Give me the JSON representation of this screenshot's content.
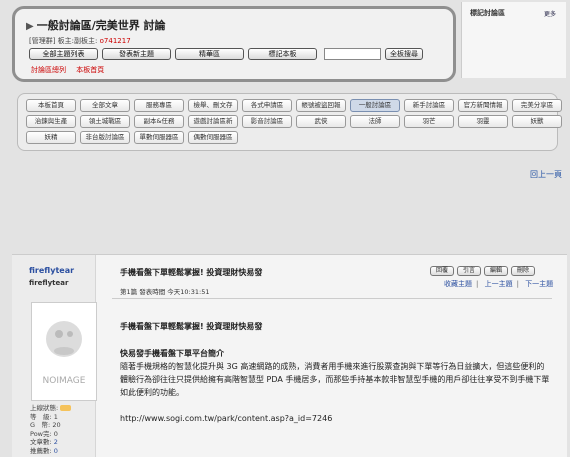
{
  "header": {
    "breadcrumb": "一般討論區/完美世界 討論",
    "meta_prefix": "[管理群] 板主:副板主:",
    "moderator": "o741217",
    "buttons": [
      "全部主題列表",
      "發表新主題",
      "精華區",
      "標記本板"
    ],
    "search_label": "全板搜尋",
    "links": [
      "討論區總列",
      "本板首頁"
    ]
  },
  "favorites": {
    "title": "標記討論區",
    "more": "更多"
  },
  "nav": {
    "items": [
      "本板首頁",
      "全部文章",
      "服務專區",
      "檢舉、刪文存",
      "各式申請區",
      "帳號被盜回報",
      "一般討論區",
      "新手討論區",
      "官方新聞情報",
      "完美分享區",
      "治鍊與生產",
      "領土城戰區",
      "副本&任務",
      "遊戲討論區新",
      "影音討論區",
      "武俠",
      "法師",
      "羽芒",
      "羽靈",
      "妖獸",
      "妖精",
      "非台版討論區",
      "單數伺服器區",
      "偶數伺服器區"
    ],
    "active": "一般討論區"
  },
  "back_to_top": "回上一頁",
  "post": {
    "author": "fireflytear",
    "author_sub": "fireflytear",
    "title": "手機看盤下單輕鬆掌握! 投資理財快易發",
    "meta": "第1篇 發表時間 今天10:31:51",
    "actions": [
      "回覆",
      "引言",
      "編輯",
      "刪除"
    ],
    "links": [
      "收藏主題",
      "上一主題",
      "下一主題"
    ],
    "body_title": "手機看盤下單輕鬆掌握! 投資理財快易發",
    "section_title": "快易發手機看盤下單平台簡介",
    "paragraph": "隨著手機規格的智慧化提升與 3G 高速網路的成熟，消費者用手機來進行股票查詢與下單等行為日益擴大，但這些便利的體驗行為卻往往只提供給擁有高階智慧型 PDA 手機居多，而那些手持基本款非智慧型手機的用戶卻往往享受不到手機下單如此便利的功能。",
    "url": "http://www.sogi.com.tw/park/content.asp?a_id=7246",
    "avatar_text": "NOIMAGE",
    "stats": {
      "label_status": "上線狀態:",
      "label_level": "等　級:",
      "level": "1",
      "label_g": "G　幣:",
      "g": "20",
      "label_pow": "Pow完:",
      "pow": "0",
      "label_posts": "文章數:",
      "posts": "2",
      "label_recommend": "推薦數:",
      "recommend": "0"
    }
  }
}
